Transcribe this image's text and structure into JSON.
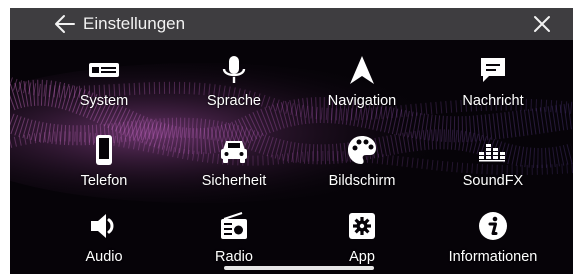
{
  "header": {
    "title": "Einstellungen",
    "back_icon": "arrow-left-icon",
    "close_icon": "close-icon"
  },
  "menu": {
    "items": [
      {
        "label": "System",
        "icon": "head-unit-icon"
      },
      {
        "label": "Sprache",
        "icon": "microphone-icon"
      },
      {
        "label": "Navigation",
        "icon": "navigation-arrow-icon"
      },
      {
        "label": "Nachricht",
        "icon": "message-bubble-icon"
      },
      {
        "label": "Telefon",
        "icon": "smartphone-icon"
      },
      {
        "label": "Sicherheit",
        "icon": "car-icon"
      },
      {
        "label": "Bildschirm",
        "icon": "palette-icon"
      },
      {
        "label": "SoundFX",
        "icon": "equalizer-icon"
      },
      {
        "label": "Audio",
        "icon": "speaker-icon"
      },
      {
        "label": "Radio",
        "icon": "radio-icon"
      },
      {
        "label": "App",
        "icon": "gear-icon"
      },
      {
        "label": "Informationen",
        "icon": "info-icon"
      }
    ]
  },
  "colors": {
    "header_bg": "#3e3d40",
    "screen_bg": "#060308",
    "wave_pink": "#d66bd0",
    "wave_violet": "#8a5cc8",
    "text": "#ffffff"
  }
}
